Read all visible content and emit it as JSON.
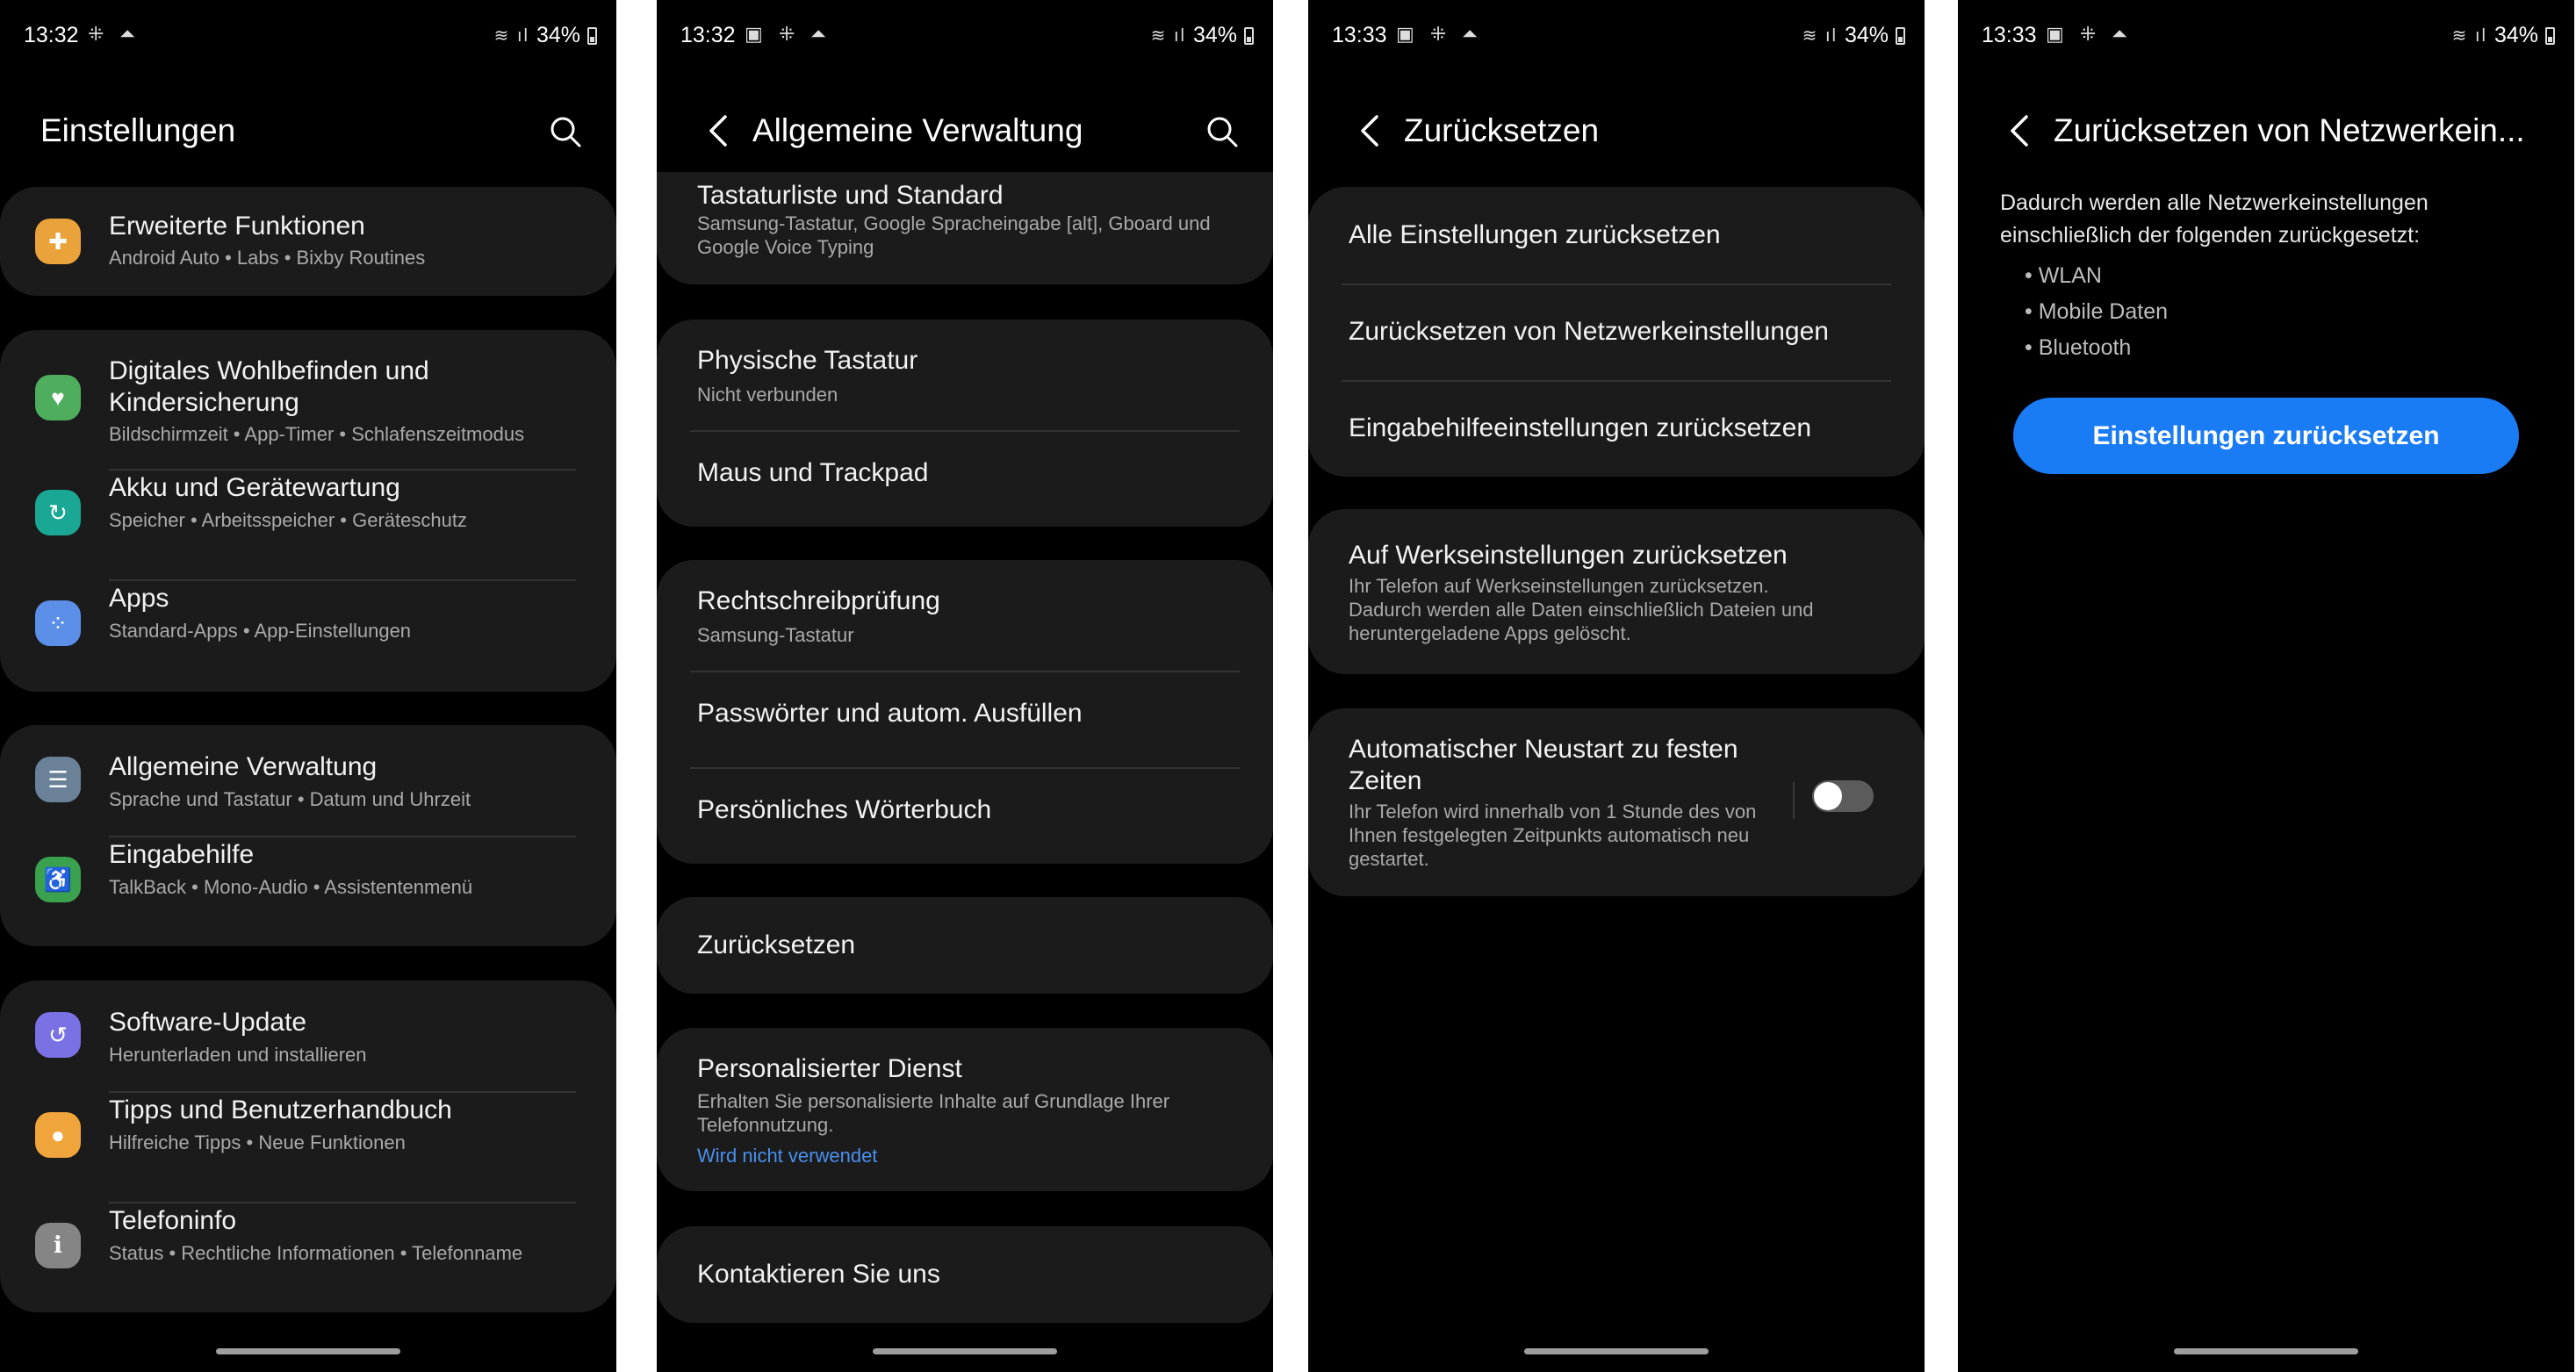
{
  "status": [
    {
      "time": "13:32",
      "notif": "⁜ ⏶",
      "battery": "34%"
    },
    {
      "time": "13:32",
      "notif": "▣ ⁜ ⏶",
      "battery": "34%"
    },
    {
      "time": "13:33",
      "notif": "▣ ⁜ ⏶",
      "battery": "34%"
    },
    {
      "time": "13:33",
      "notif": "▣ ⁜ ⏶",
      "battery": "34%"
    }
  ],
  "screen1": {
    "title": "Einstellungen",
    "items": [
      {
        "label": "Erweiterte Funktionen",
        "sub": "Android Auto  •  Labs  •  Bixby Routines",
        "icon": "plus-gear-icon",
        "color": "#e9a33a",
        "glyph": "✚"
      },
      {
        "label": "Digitales Wohlbefinden und",
        "label2": "Kindersicherung",
        "sub": "Bildschirmzeit  •  App-Timer  •  Schlafenszeitmodus",
        "icon": "heart-circle-icon",
        "color": "#4fae5d",
        "glyph": "♥"
      },
      {
        "label": "Akku und Gerätewartung",
        "sub": "Speicher  •  Arbeitsspeicher  •  Geräteschutz",
        "icon": "refresh-circle-icon",
        "color": "#1aa894",
        "glyph": "↻"
      },
      {
        "label": "Apps",
        "sub": "Standard-Apps  •  App-Einstellungen",
        "icon": "apps-grid-icon",
        "color": "#5b8fe8",
        "glyph": "⁘"
      },
      {
        "label": "Allgemeine Verwaltung",
        "sub": "Sprache und Tastatur  •  Datum und Uhrzeit",
        "icon": "sliders-icon",
        "color": "#6a8197",
        "glyph": "☰"
      },
      {
        "label": "Eingabehilfe",
        "sub": "TalkBack  •  Mono-Audio  •  Assistentenmenü",
        "icon": "accessibility-icon",
        "color": "#3aa24f",
        "glyph": "♿"
      },
      {
        "label": "Software-Update",
        "sub": "Herunterladen und installieren",
        "icon": "update-icon",
        "color": "#7a72e4",
        "glyph": "↺"
      },
      {
        "label": "Tipps und Benutzerhandbuch",
        "sub": "Hilfreiche Tipps  •  Neue Funktionen",
        "icon": "lightbulb-icon",
        "color": "#f0a43c",
        "glyph": "●"
      },
      {
        "label": "Telefoninfo",
        "sub": "Status  •  Rechtliche Informationen  •  Telefonname",
        "icon": "info-icon",
        "color": "#858585",
        "glyph": "i"
      }
    ]
  },
  "screen2": {
    "title": "Allgemeine Verwaltung",
    "items": [
      {
        "label": "Tastaturliste und Standard",
        "sub": "Samsung-Tastatur, Google Spracheingabe [alt], Gboard und",
        "sub2": "Google Voice Typing"
      },
      {
        "label": "Physische Tastatur",
        "sub": "Nicht verbunden"
      },
      {
        "label": "Maus und Trackpad"
      },
      {
        "label": "Rechtschreibprüfung",
        "sub": "Samsung-Tastatur"
      },
      {
        "label": "Passwörter und autom. Ausfüllen"
      },
      {
        "label": "Persönliches Wörterbuch"
      },
      {
        "label": "Zurücksetzen"
      },
      {
        "label": "Personalisierter Dienst",
        "sub": "Erhalten Sie personalisierte Inhalte auf Grundlage Ihrer",
        "sub2": "Telefonnutzung.",
        "link": "Wird nicht verwendet"
      },
      {
        "label": "Kontaktieren Sie uns"
      }
    ]
  },
  "screen3": {
    "title": "Zurücksetzen",
    "items": [
      {
        "label": "Alle Einstellungen zurücksetzen"
      },
      {
        "label": "Zurücksetzen von Netzwerkeinstellungen"
      },
      {
        "label": "Eingabehilfeeinstellungen zurücksetzen"
      },
      {
        "label": "Auf Werkseinstellungen zurücksetzen",
        "sub": "Ihr Telefon auf Werkseinstellungen zurücksetzen.",
        "sub2": "Dadurch werden alle Daten einschließlich Dateien und",
        "sub3": "heruntergeladene Apps gelöscht."
      },
      {
        "label": "Automatischer Neustart zu festen",
        "label2": "Zeiten",
        "sub": "Ihr Telefon wird innerhalb von 1 Stunde des von",
        "sub2": "Ihnen festgelegten Zeitpunkts automatisch neu",
        "sub3": "gestartet.",
        "toggle_on": false
      }
    ]
  },
  "screen4": {
    "title": "Zurücksetzen von Netzwerkein...",
    "desc1": "Dadurch werden alle Netzwerkeinstellungen",
    "desc2": "einschließlich der folgenden zurückgesetzt:",
    "bullets": [
      "• WLAN",
      "• Mobile Daten",
      "• Bluetooth"
    ],
    "button": "Einstellungen zurücksetzen",
    "accent": "#1a7cf5"
  }
}
